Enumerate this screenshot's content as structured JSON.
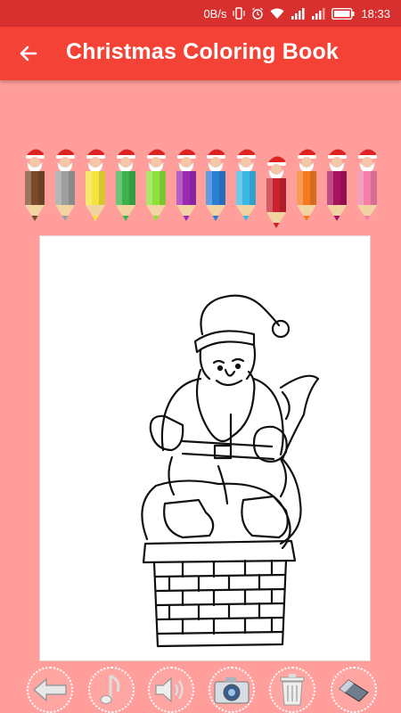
{
  "status_bar": {
    "net_speed": "0B/s",
    "time": "18:33"
  },
  "app_bar": {
    "title": "Christmas Coloring Book"
  },
  "palette": {
    "colors": [
      "#7a4a2a",
      "#9e9e9e",
      "#f5e23a",
      "#3cb34a",
      "#8ee03a",
      "#9c2ab5",
      "#2a7fd4",
      "#3ab7e6",
      "#c8232f",
      "#f47a20",
      "#a8125e",
      "#f47fa8"
    ],
    "selected_index": 8
  },
  "canvas": {
    "image": "santa-on-chimney-outline"
  },
  "toolbar": {
    "buttons": [
      "undo-arrow",
      "music-note",
      "speaker",
      "camera",
      "trash",
      "eraser"
    ]
  }
}
